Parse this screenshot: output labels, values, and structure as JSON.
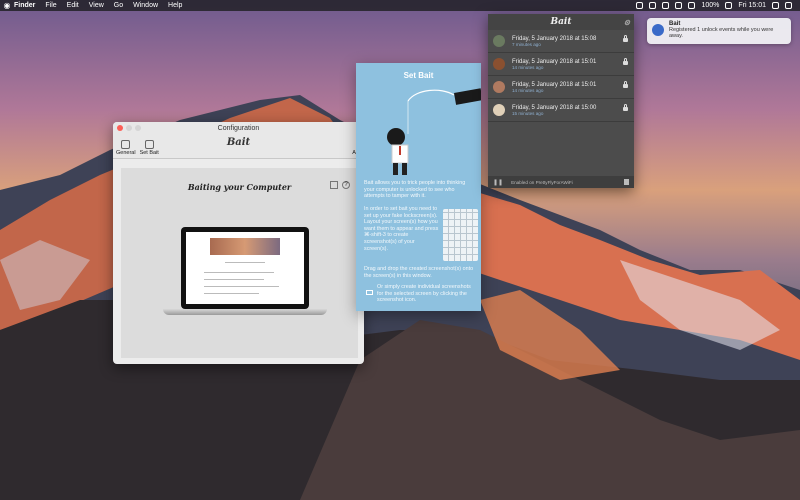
{
  "menubar": {
    "apple": "",
    "items": [
      "Finder",
      "File",
      "Edit",
      "View",
      "Go",
      "Window",
      "Help"
    ],
    "battery": "100%",
    "clock": "Fri 15:01"
  },
  "notification": {
    "title": "Bait",
    "body": "Registered 1 unlock events while you were away."
  },
  "config": {
    "title": "Configuration",
    "toolbar": {
      "general": "General",
      "setbait": "Set Bait",
      "about": "Abo",
      "logo": "Bait"
    },
    "heading": "Baiting your Computer",
    "help": "?"
  },
  "setbait": {
    "title": "Set Bait",
    "p1": "Bait allows you to trick people into thinking your computer is unlocked to see who attempts to tamper with it.",
    "p2": "In order to set bait you need to set up your fake lockscreen(s). Layout your screen(s) how you want them to appear and press ⌘-shift-3 to create screenshot(s) of your screen(s).",
    "p3": "Drag and drop the created screenshot(s) onto the screen(s) in this window.",
    "p4": "Or simply create individual screenshots for the selected screen by clicking the screenshot icon."
  },
  "events": {
    "logo": "Bait",
    "items": [
      {
        "date": "Friday, 5 January 2018 at 15:08",
        "ago": "7 minutes ago",
        "avatar_color": "#6a7a60"
      },
      {
        "date": "Friday, 5 January 2018 at 15:01",
        "ago": "14 minutes ago",
        "avatar_color": "#8a5030"
      },
      {
        "date": "Friday, 5 January 2018 at 15:01",
        "ago": "14 minutes ago",
        "avatar_color": "#b07a60"
      },
      {
        "date": "Friday, 5 January 2018 at 15:00",
        "ago": "15 minutes ago",
        "avatar_color": "#e0d0b8"
      }
    ],
    "footer": "Enabled on PrettyFlyForAWiFi"
  }
}
